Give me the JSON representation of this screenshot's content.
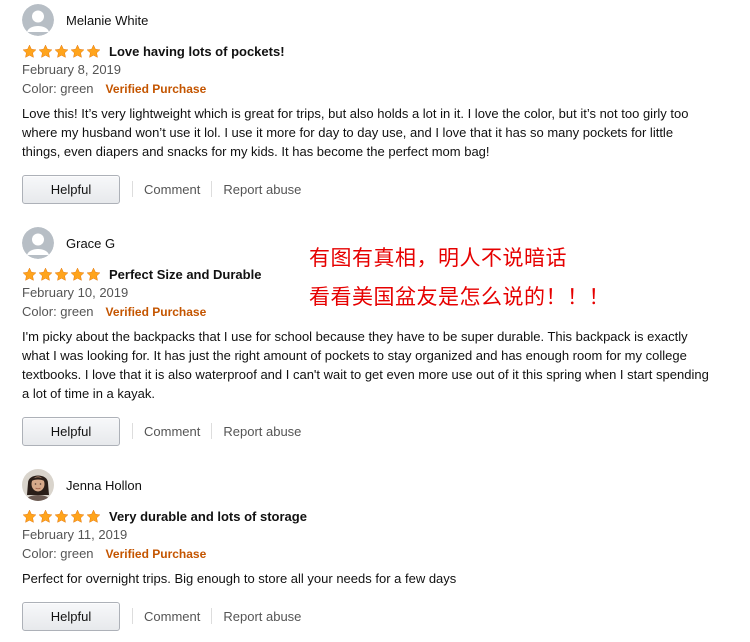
{
  "reviews": [
    {
      "reviewer": "Melanie White",
      "avatar": "default-avatar",
      "rating": 5,
      "title": "Love having lots of pockets!",
      "date": "February 8, 2019",
      "color": "Color: green",
      "badge": "Verified Purchase",
      "body": "Love this! It’s very lightweight which is great for trips, but also holds a lot in it. I love the color, but it’s not too girly too where my husband won’t use it lol. I use it more for day to day use, and I love that it has so many pockets for little things, even diapers and snacks for my kids. It has become the perfect mom bag!",
      "helpful_label": "Helpful",
      "comment_label": "Comment",
      "report_label": "Report abuse"
    },
    {
      "reviewer": "Grace G",
      "avatar": "default-avatar",
      "rating": 5,
      "title": "Perfect Size and Durable",
      "date": "February 10, 2019",
      "color": "Color: green",
      "badge": "Verified Purchase",
      "body": "I'm picky about the backpacks that I use for school because they have to be super durable. This backpack is exactly what I was looking for. It has just the right amount of pockets to stay organized and has enough room for my college textbooks. I love that it is also waterproof and I can't wait to get even more use out of it this spring when I start spending a lot of time in a kayak.",
      "helpful_label": "Helpful",
      "comment_label": "Comment",
      "report_label": "Report abuse"
    },
    {
      "reviewer": "Jenna Hollon",
      "avatar": "photo-avatar",
      "rating": 5,
      "title": "Very durable and lots of storage",
      "date": "February 11, 2019",
      "color": "Color: green",
      "badge": "Verified Purchase",
      "body": "Perfect for overnight trips. Big enough to store all your needs for a few days",
      "helpful_label": "Helpful",
      "comment_label": "Comment",
      "report_label": "Report abuse"
    }
  ],
  "overlay": {
    "line1": "有图有真相，明人不说暗话",
    "line2": "看看美国盆友是怎么说的！！！"
  },
  "colors": {
    "star": "#ffa41c",
    "verified": "#c45500",
    "overlay_text": "#e60000",
    "avatar_bg": "#b7bec5"
  }
}
